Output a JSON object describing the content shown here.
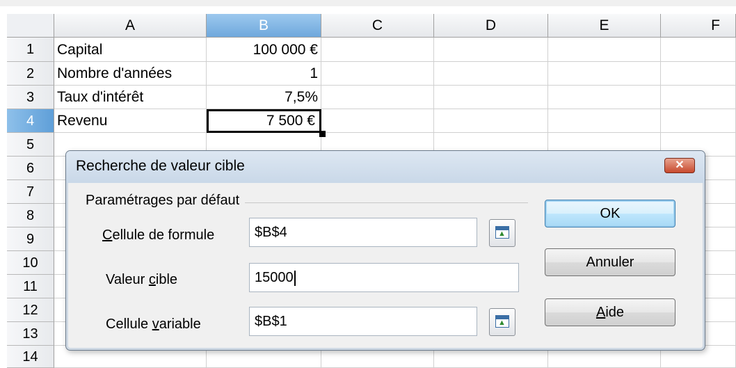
{
  "sheet": {
    "columns": [
      "A",
      "B",
      "C",
      "D",
      "E",
      "F"
    ],
    "selected_column": "B",
    "rows": [
      "1",
      "2",
      "3",
      "4",
      "5",
      "6",
      "7",
      "8",
      "9",
      "10",
      "11",
      "12",
      "13",
      "14"
    ],
    "selected_row": "4",
    "cells": {
      "a1": "Capital",
      "b1": "100 000 €",
      "a2": "Nombre d'années",
      "b2": "1",
      "a3": "Taux d'intérêt",
      "b3": "7,5%",
      "a4": "Revenu",
      "b4": "7 500 €"
    },
    "active_cell": "B4",
    "selection_color": "#6fa8dc"
  },
  "dialog": {
    "title": "Recherche de valeur cible",
    "close_icon": "close-icon",
    "group_label": "Paramétrages par défaut",
    "formula_cell": {
      "label_pre": "",
      "label_key": "C",
      "label_post": "ellule de formule",
      "value": "$B$4"
    },
    "target_value": {
      "label_pre": "Valeur ",
      "label_key": "c",
      "label_post": "ible",
      "value": "15000"
    },
    "variable_cell": {
      "label_pre": "Cellule ",
      "label_key": "v",
      "label_post": "ariable",
      "value": "$B$1"
    },
    "buttons": {
      "ok": "OK",
      "cancel": "Annuler",
      "help_key": "A",
      "help_rest": "ide"
    },
    "shrink_icon": "shrink-reference-icon"
  }
}
